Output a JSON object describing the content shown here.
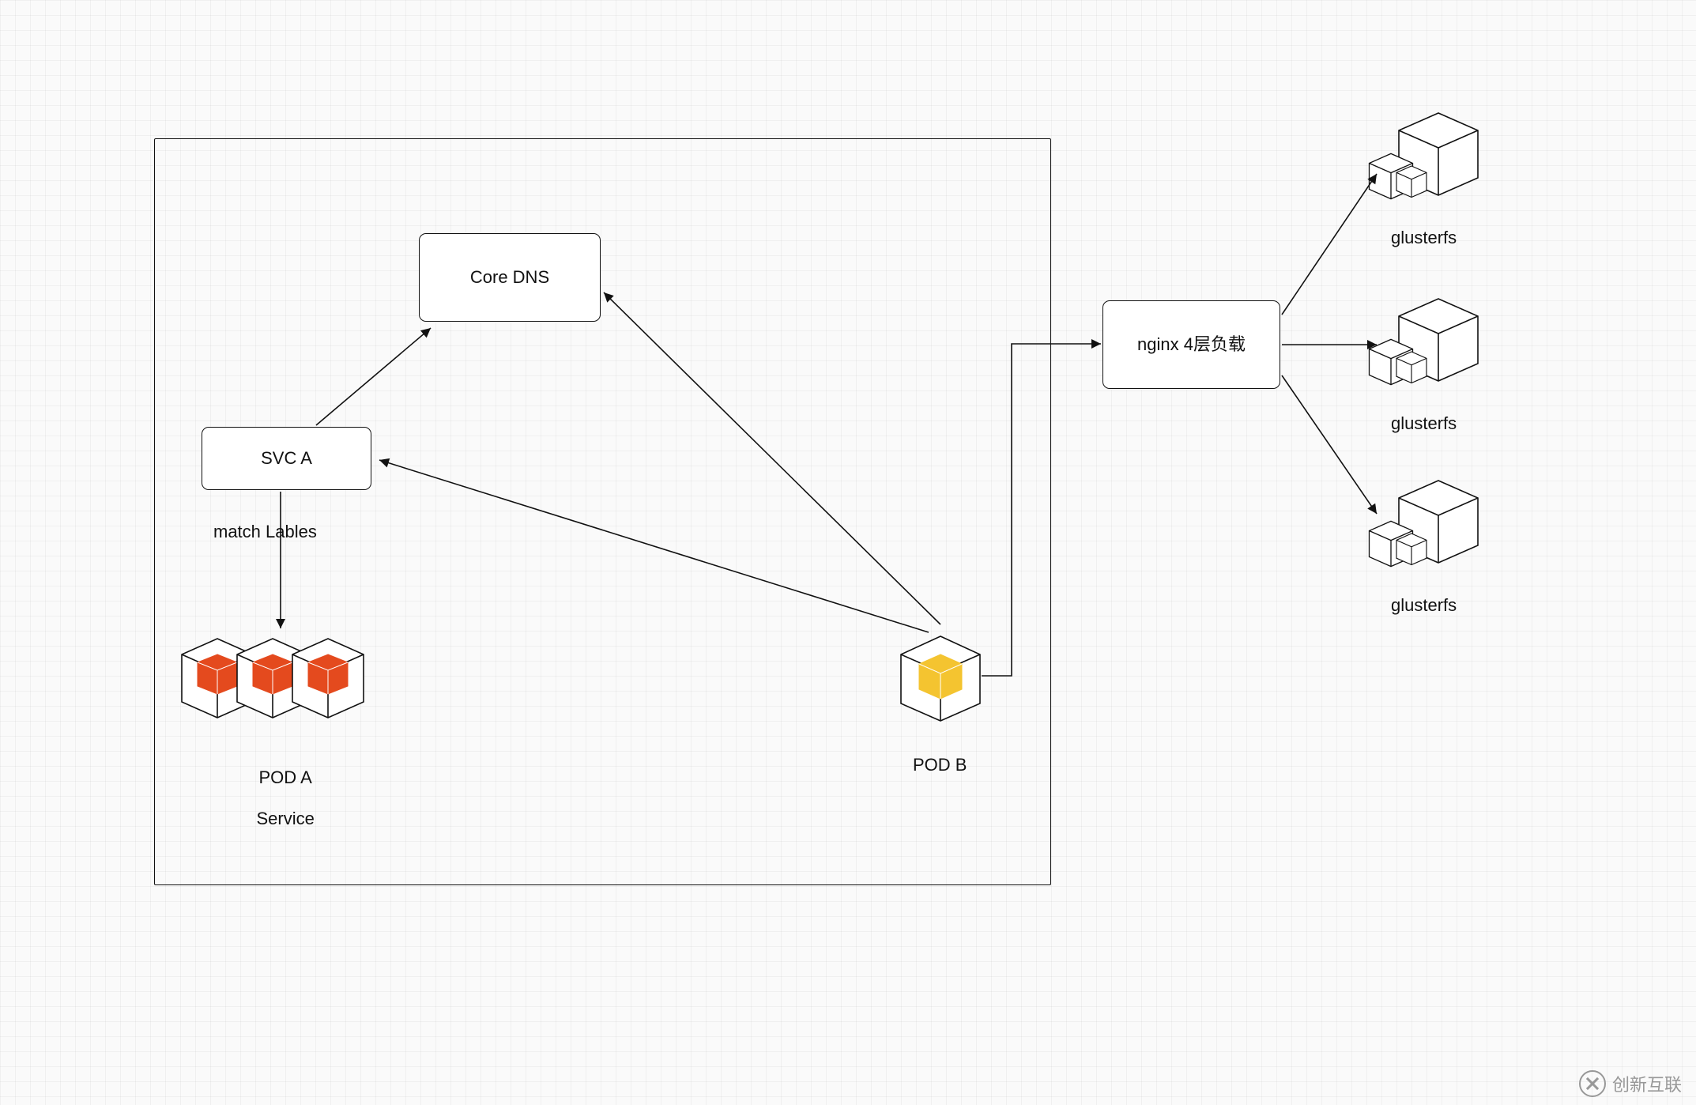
{
  "diagram": {
    "nodes": {
      "coredns": {
        "label": "Core DNS"
      },
      "svca": {
        "label": "SVC A"
      },
      "nginx": {
        "label": "nginx 4层负载"
      }
    },
    "edge_labels": {
      "match_labels": "match Lables"
    },
    "pods": {
      "poda": {
        "line1": "POD A",
        "line2": "Service"
      },
      "podb": {
        "label": "POD B"
      }
    },
    "glusterfs": {
      "label": "glusterfs",
      "count": 3
    },
    "watermark": "创新互联"
  }
}
